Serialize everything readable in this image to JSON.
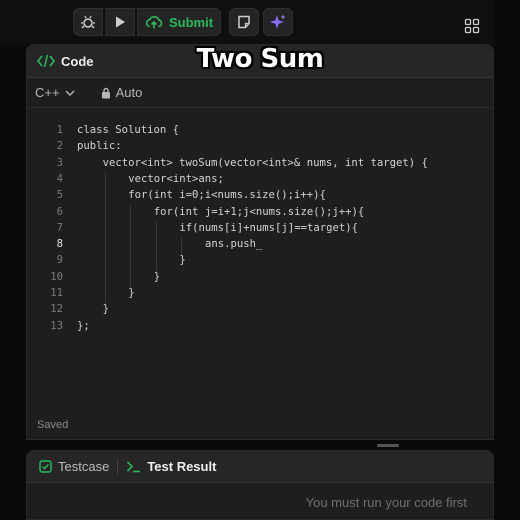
{
  "toolbar": {
    "submit_label": "Submit",
    "icons": [
      "debug-icon",
      "play-icon",
      "cloud-upload-icon",
      "notes-icon",
      "sparkle-icon",
      "layout-grid-icon"
    ],
    "submit_color": "#2cbb5d",
    "sparkle_color": "#8b6cf6"
  },
  "overlay": {
    "title": "Two Sum"
  },
  "code_panel": {
    "title": "Code",
    "language": "C++",
    "mode": "Auto",
    "status": "Saved",
    "active_line": "8",
    "lines": [
      {
        "n": "1",
        "indent": 0,
        "text": "class Solution {"
      },
      {
        "n": "2",
        "indent": 0,
        "text": "public:"
      },
      {
        "n": "3",
        "indent": 1,
        "text": "vector<int> twoSum(vector<int>& nums, int target) {"
      },
      {
        "n": "4",
        "indent": 2,
        "text": "vector<int>ans;"
      },
      {
        "n": "5",
        "indent": 2,
        "text": "for(int i=0;i<nums.size();i++){"
      },
      {
        "n": "6",
        "indent": 3,
        "text": "for(int j=i+1;j<nums.size();j++){"
      },
      {
        "n": "7",
        "indent": 4,
        "text": "if(nums[i]+nums[j]==target){"
      },
      {
        "n": "8",
        "indent": 5,
        "text": "ans.push_"
      },
      {
        "n": "9",
        "indent": 4,
        "text": "}"
      },
      {
        "n": "10",
        "indent": 3,
        "text": "}"
      },
      {
        "n": "11",
        "indent": 2,
        "text": "}"
      },
      {
        "n": "12",
        "indent": 1,
        "text": "}"
      },
      {
        "n": "13",
        "indent": 0,
        "text": "};"
      }
    ]
  },
  "bottom_panel": {
    "tab_testcase": "Testcase",
    "tab_result": "Test Result",
    "message": "You must run your code first"
  }
}
